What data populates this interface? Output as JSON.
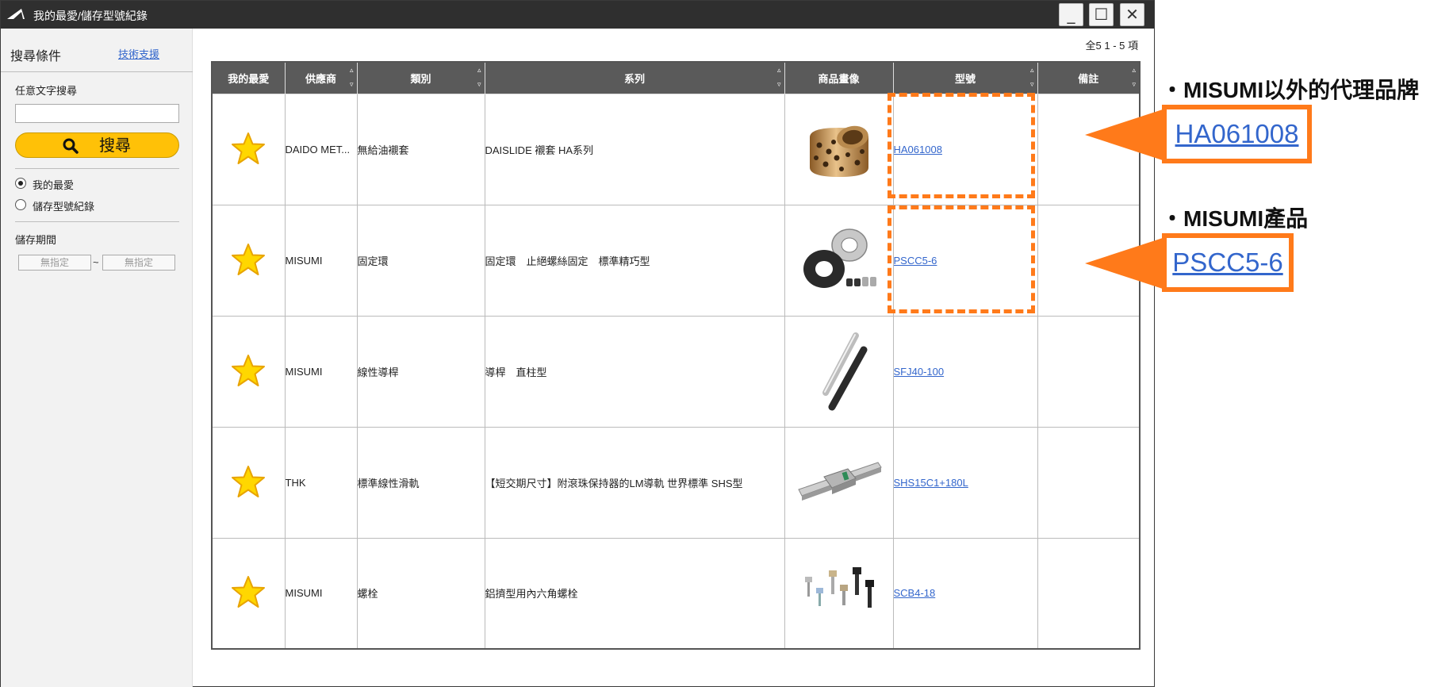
{
  "window": {
    "title": "我的最愛/儲存型號紀錄",
    "minimize_glyph": "_",
    "maximize_glyph": "☐",
    "close_glyph": "✕"
  },
  "sidebar": {
    "title": "搜尋條件",
    "support_link": "技術支援",
    "keyword_label": "任意文字搜尋",
    "keyword_value": "",
    "search_button": "搜尋",
    "radio_options": [
      {
        "label": "我的最愛",
        "selected": true
      },
      {
        "label": "儲存型號紀錄",
        "selected": false
      }
    ],
    "period_label": "儲存期間",
    "period_from": "無指定",
    "period_to": "無指定",
    "period_sep": "~"
  },
  "results": {
    "count_text": "全5 1 - 5 項"
  },
  "table": {
    "headers": [
      "我的最愛",
      "供應商",
      "類別",
      "系列",
      "商品畫像",
      "型號",
      "備註"
    ],
    "rows": [
      {
        "supplier": "DAIDO MET...",
        "category": "無給油襯套",
        "series": "DAISLIDE 襯套 HA系列",
        "image": "bronze-bushing-image",
        "model": "HA061008",
        "note": ""
      },
      {
        "supplier": "MISUMI",
        "category": "固定環",
        "series": "固定環　止絕螺絲固定　標準精巧型",
        "image": "shaft-collar-image",
        "model": "PSCC5-6",
        "note": ""
      },
      {
        "supplier": "MISUMI",
        "category": "線性導桿",
        "series": "導桿　直柱型",
        "image": "linear-shaft-image",
        "model": "SFJ40-100",
        "note": ""
      },
      {
        "supplier": "THK",
        "category": "標準線性滑軌",
        "series": "【短交期尺寸】附滾珠保持器的LM導軌 世界標準 SHS型",
        "image": "linear-guide-image",
        "model": "SHS15C1+180L",
        "note": ""
      },
      {
        "supplier": "MISUMI",
        "category": "螺栓",
        "series": "鋁擠型用內六角螺栓",
        "image": "hex-bolts-image",
        "model": "SCB4-18",
        "note": ""
      }
    ]
  },
  "annotations": {
    "title_1": "・MISUMI以外的代理品牌",
    "model_1": "HA061008",
    "title_2": "・MISUMI產品",
    "model_2": "PSCC5-6"
  },
  "colors": {
    "accent_orange": "#ff7a1a",
    "search_yellow": "#ffc107",
    "link_blue": "#3366cc",
    "header_gray": "#5a5a5a",
    "star_yellow": "#ffd700"
  }
}
